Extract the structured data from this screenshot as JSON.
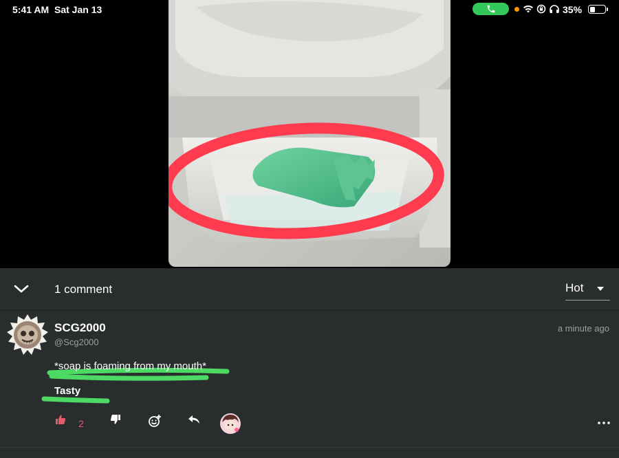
{
  "status_bar": {
    "time": "5:41 AM",
    "date": "Sat Jan 13",
    "battery": "35%",
    "call_color": "#34c759",
    "icons": [
      "phone-icon",
      "orange-dot",
      "wifi-icon",
      "screen-lock-icon",
      "headphones-icon",
      "battery-icon"
    ]
  },
  "media": {
    "description_icon": "soap-dish-photo",
    "circle_color": "#ff3b4f"
  },
  "comments_header": {
    "count_label": "1 comment",
    "sort_value": "Hot"
  },
  "comment": {
    "username": "SCG2000",
    "handle": "@Scg2000",
    "timestamp": "a minute ago",
    "line1": "*soap is foaming from my mouth*",
    "line2": "Tasty",
    "like_count": "2",
    "highlight_color": "#4cd964"
  },
  "colors": {
    "panel_bg": "#2a2d2d",
    "like_color": "#e25b6a",
    "muted_text": "#9a9f9f"
  }
}
